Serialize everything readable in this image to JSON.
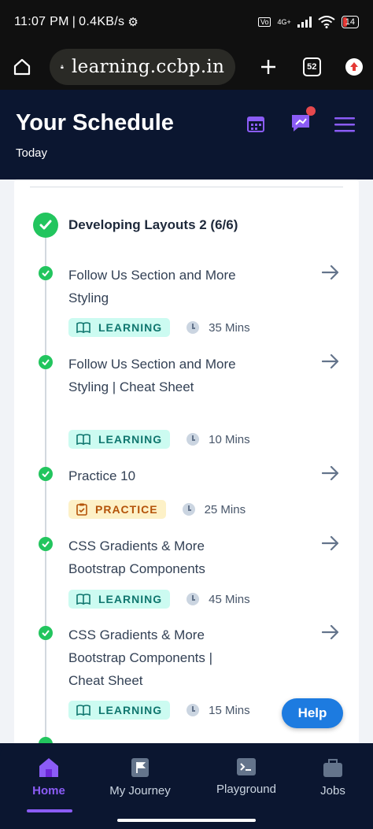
{
  "status_bar": {
    "time": "11:07 PM",
    "network_speed": "0.4KB/s",
    "signal_label": "4G+",
    "battery": "14"
  },
  "browser": {
    "url": "learning.ccbp.in",
    "tab_count": "52"
  },
  "header": {
    "title": "Your Schedule",
    "subtitle": "Today"
  },
  "section": {
    "title": "Developing Layouts 2 (6/6)"
  },
  "items": [
    {
      "title": "Follow Us Section and More Styling",
      "badge": "LEARNING",
      "duration": "35 Mins"
    },
    {
      "title": "Follow Us Section and More Styling | Cheat Sheet",
      "badge": "LEARNING",
      "duration": "10 Mins"
    },
    {
      "title": "Practice 10",
      "badge": "PRACTICE",
      "duration": "25 Mins"
    },
    {
      "title": "CSS Gradients & More Bootstrap Components",
      "badge": "LEARNING",
      "duration": "45 Mins"
    },
    {
      "title": "CSS Gradients & More Bootstrap Components | Cheat Sheet",
      "badge": "LEARNING",
      "duration": "15 Mins"
    }
  ],
  "help_label": "Help",
  "nav": {
    "home": "Home",
    "journey": "My Journey",
    "playground": "Playground",
    "jobs": "Jobs"
  },
  "colors": {
    "brand_dark": "#0b1630",
    "accent_purple": "#8b5cf6",
    "success_green": "#22c55e",
    "help_blue": "#1d7be0"
  }
}
